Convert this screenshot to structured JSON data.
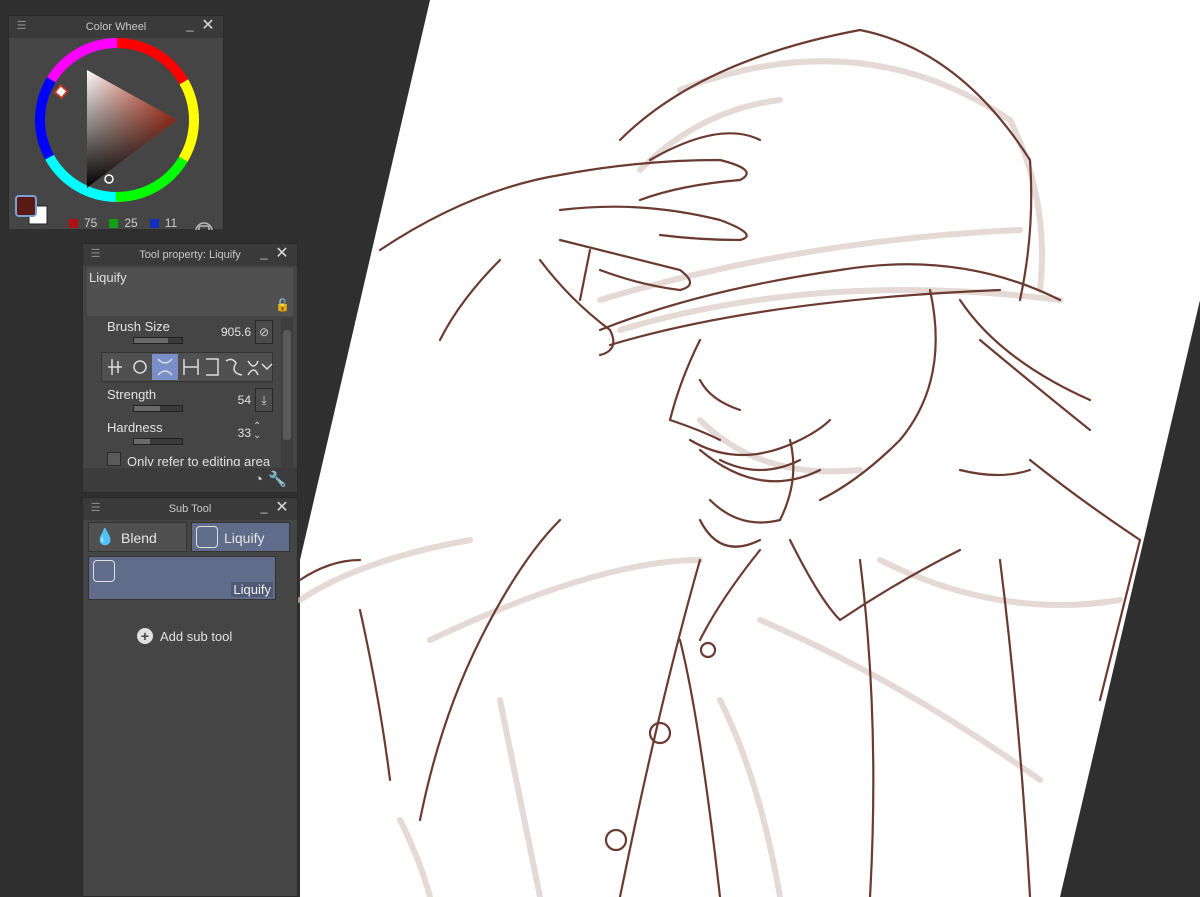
{
  "color_wheel": {
    "title": "Color Wheel",
    "main_color": "#5a1a14",
    "r": "75",
    "g": "25",
    "b": "11",
    "icons": [
      "menu-icon",
      "minimize-icon",
      "close-icon",
      "swap-colors-icon",
      "transparent-color-icon",
      "wheel-mode-icon"
    ]
  },
  "tool_property": {
    "title": "Tool property: Liquify",
    "tool_name": "Liquify",
    "brush_size": {
      "label": "Brush Size",
      "value": "905.6",
      "level": 0.7
    },
    "strength": {
      "label": "Strength",
      "value": "54",
      "level": 0.54
    },
    "hardness": {
      "label": "Hardness",
      "value": "33",
      "level": 0.33
    },
    "mode_selected_index": 2,
    "mode_icons": [
      "push-icon",
      "expand-icon",
      "pinch-icon",
      "push-left-icon",
      "push-right-icon",
      "twist-left-icon",
      "twist-right-icon"
    ],
    "checkbox_label": "Only refer to editing area"
  },
  "sub_tool": {
    "title": "Sub Tool",
    "tabs": [
      "Blend",
      "Liquify"
    ],
    "active_tab": "Liquify",
    "items": [
      {
        "label": "Liquify"
      }
    ],
    "add_label": "Add sub tool"
  },
  "colors": {
    "panel_bg": "#454545",
    "selection": "#606c8a",
    "ink": "#6b3a30"
  }
}
